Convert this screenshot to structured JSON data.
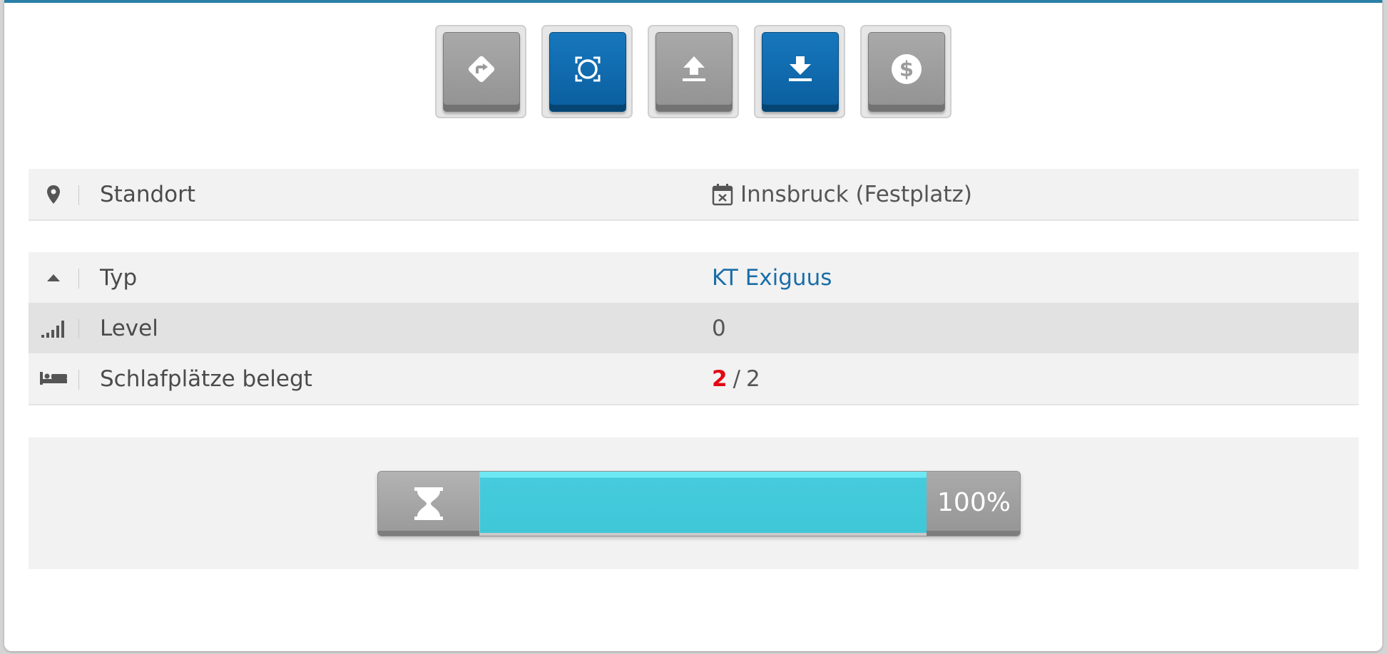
{
  "toolbar": {
    "buttons": [
      {
        "icon": "directions-icon",
        "style": "gray"
      },
      {
        "icon": "focus-frame-icon",
        "style": "blue"
      },
      {
        "icon": "upload-icon",
        "style": "gray"
      },
      {
        "icon": "download-icon",
        "style": "blue"
      },
      {
        "icon": "dollar-icon",
        "style": "gray"
      }
    ]
  },
  "info": {
    "standort": {
      "label": "Standort",
      "value": "Innsbruck (Festplatz)"
    },
    "typ": {
      "label": "Typ",
      "value": "KT Exiguus"
    },
    "level": {
      "label": "Level",
      "value": "0"
    },
    "schlafplaetze": {
      "label": "Schlafplätze belegt",
      "occupied": "2",
      "separator": "/",
      "total": "2"
    }
  },
  "progress": {
    "percent_label": "100%",
    "fraction": 1.0
  },
  "colors": {
    "accent_blue": "#0a5e9e",
    "link": "#1a6ea8",
    "alert_red": "#e30613",
    "progress_fill": "#3fc7d8"
  }
}
